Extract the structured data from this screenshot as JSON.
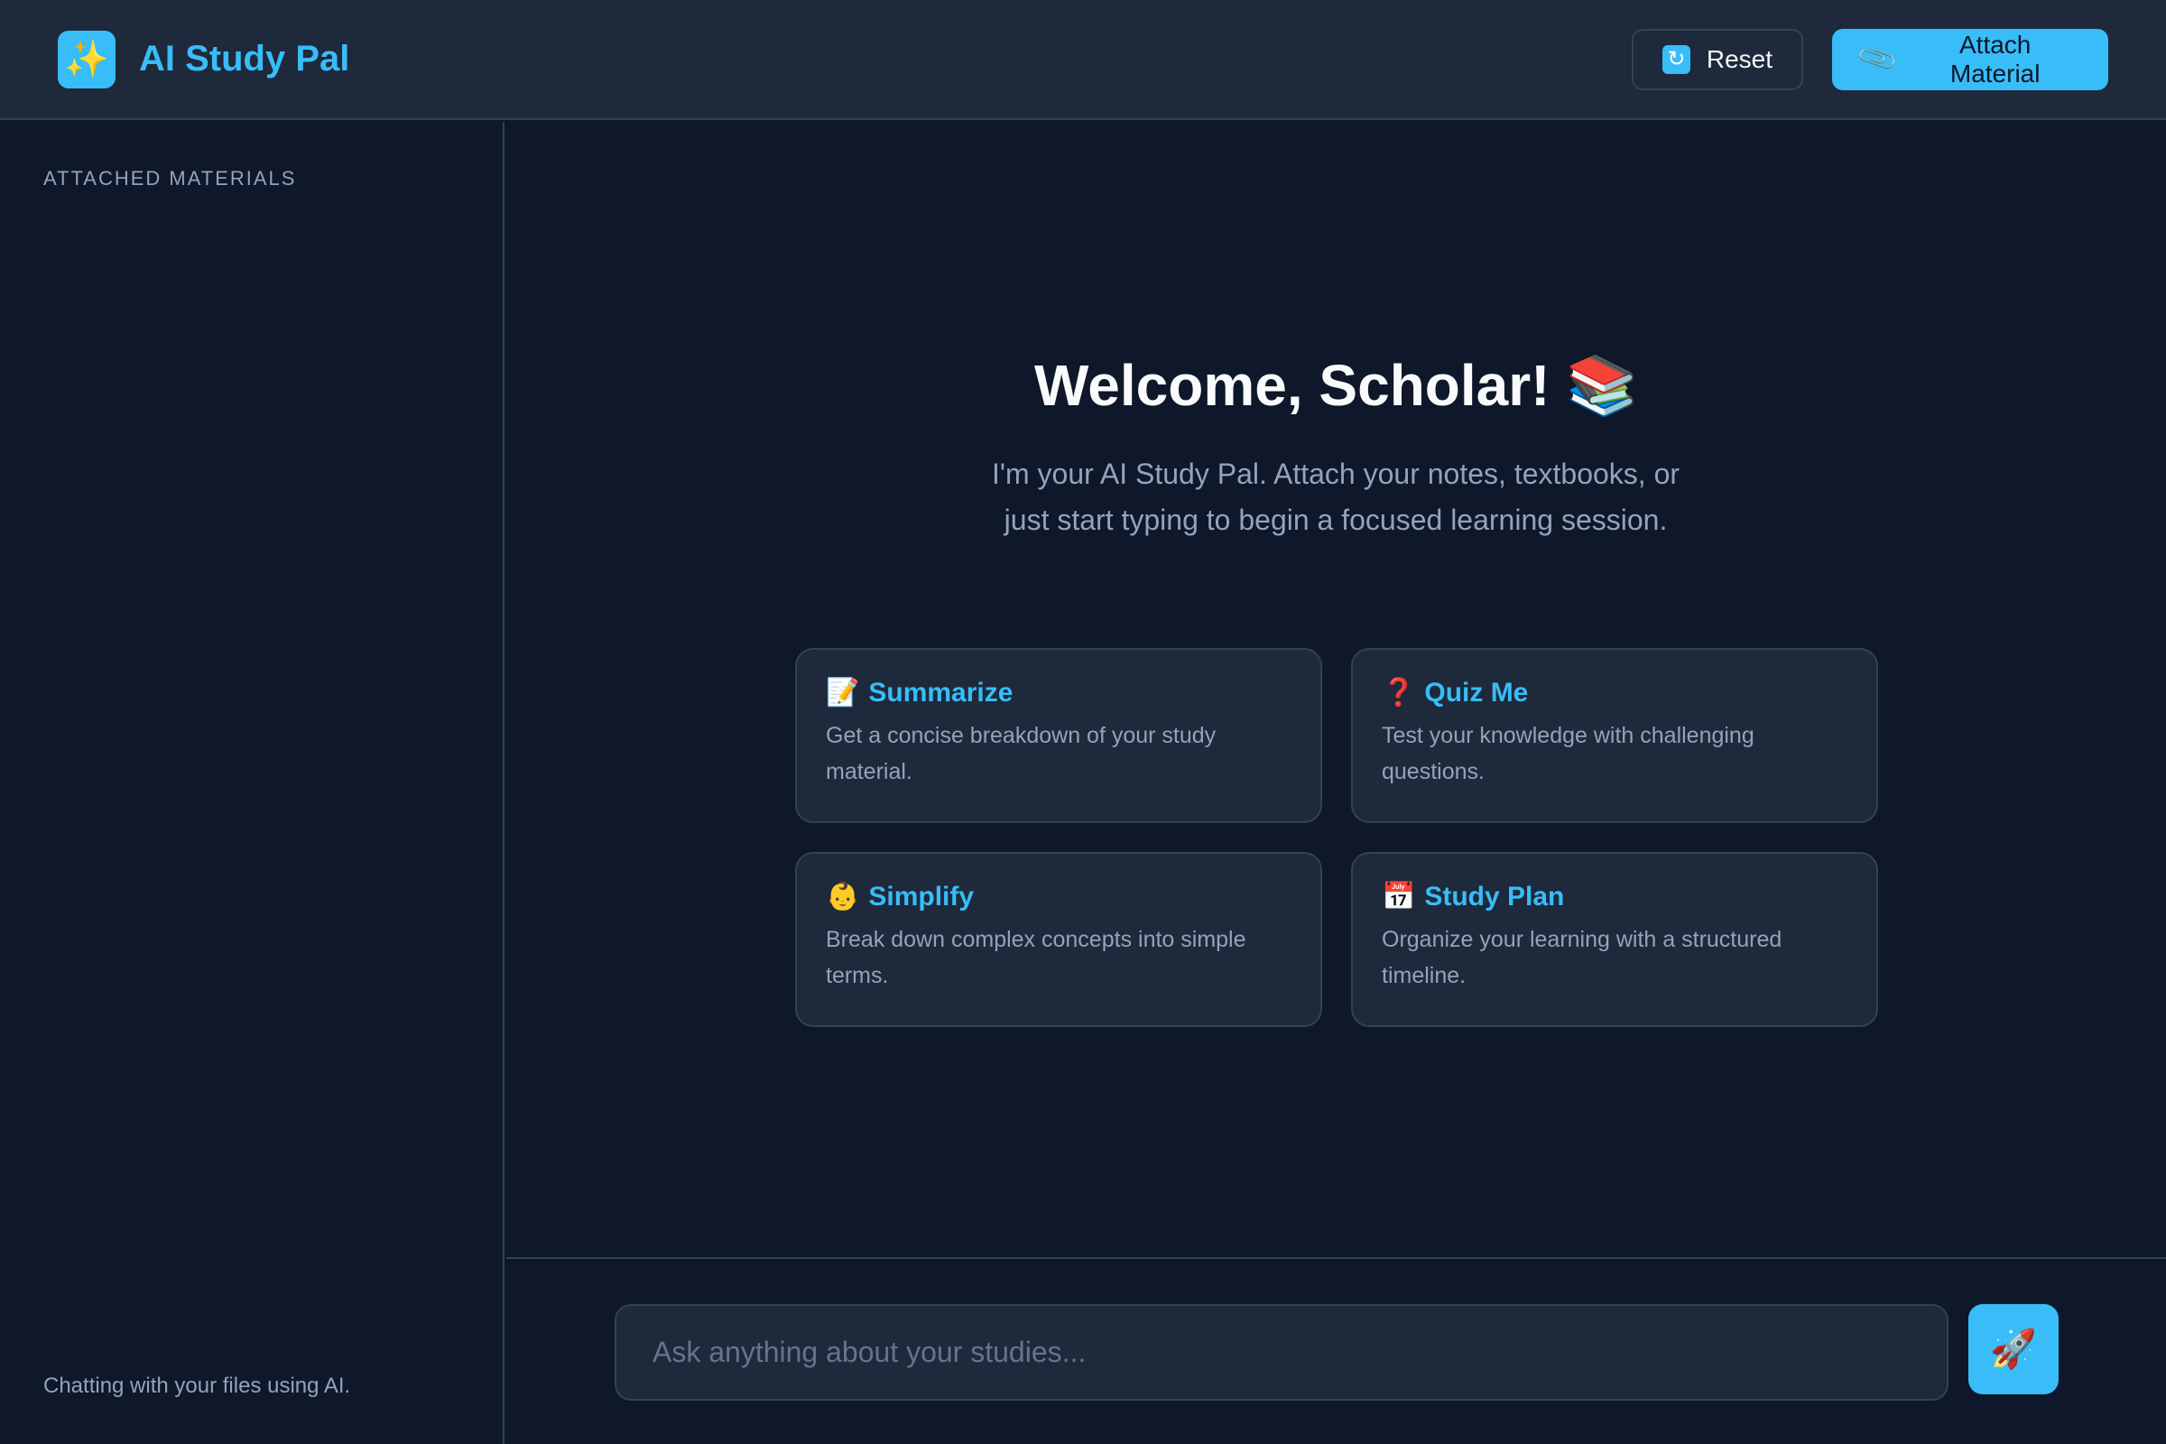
{
  "header": {
    "logo_icon": "sparkles-icon",
    "logo_glyph": "✨",
    "title": "AI Study Pal",
    "reset_label": "Reset",
    "reset_icon": "refresh-icon",
    "attach_label": "Attach Material",
    "attach_icon": "paperclip-icon"
  },
  "sidebar": {
    "heading": "ATTACHED MATERIALS",
    "footer": "Chatting with your files using AI."
  },
  "main": {
    "welcome_title": "Welcome, Scholar! 📚",
    "welcome_subtitle": "I'm your AI Study Pal. Attach your notes, textbooks, or just start typing to begin a focused learning session.",
    "cards": [
      {
        "icon": "memo-icon",
        "glyph": "📝",
        "title": "Summarize",
        "description": "Get a concise breakdown of your study material."
      },
      {
        "icon": "question-icon",
        "glyph": "❓",
        "title": "Quiz Me",
        "description": "Test your knowledge with challenging questions."
      },
      {
        "icon": "baby-icon",
        "glyph": "👶",
        "title": "Simplify",
        "description": "Break down complex concepts into simple terms."
      },
      {
        "icon": "calendar-icon",
        "glyph": "📅",
        "title": "Study Plan",
        "description": "Organize your learning with a structured timeline."
      }
    ]
  },
  "composer": {
    "placeholder": "Ask anything about your studies...",
    "value": "",
    "send_icon": "rocket-icon",
    "send_glyph": "🚀"
  },
  "colors": {
    "accent": "#38bdf8",
    "background": "#0f172a",
    "panel": "#1e293b",
    "border": "#334155",
    "muted_text": "#94a3b8"
  }
}
